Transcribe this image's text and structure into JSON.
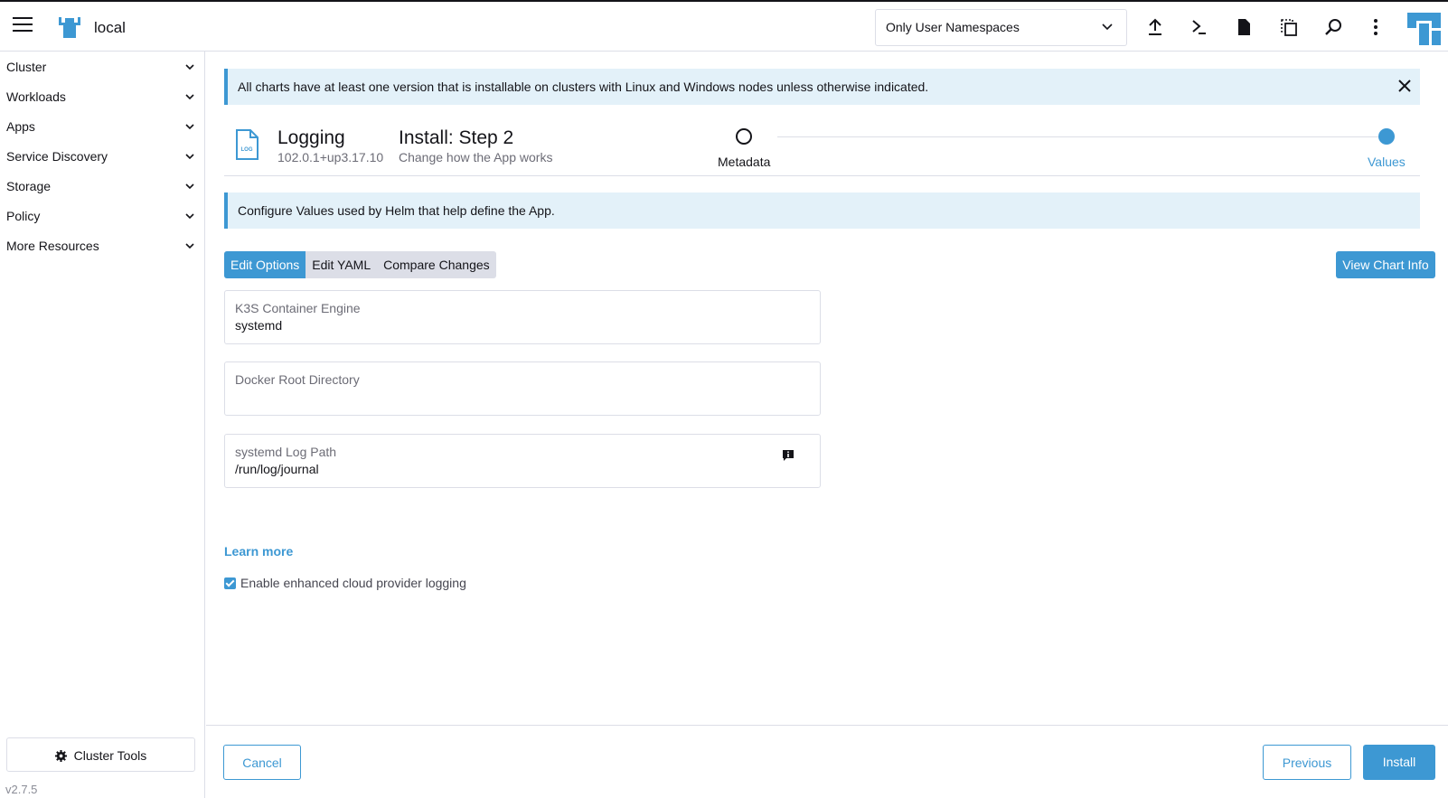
{
  "header": {
    "cluster_name": "local",
    "namespace_select": "Only User Namespaces",
    "icons": [
      "menu-icon",
      "cluster-logo-icon",
      "upload-icon",
      "terminal-icon",
      "file-icon",
      "copy-icon",
      "search-icon",
      "kebab-icon",
      "avatar"
    ]
  },
  "sidebar": {
    "items": [
      {
        "label": "Cluster"
      },
      {
        "label": "Workloads"
      },
      {
        "label": "Apps"
      },
      {
        "label": "Service Discovery"
      },
      {
        "label": "Storage"
      },
      {
        "label": "Policy"
      },
      {
        "label": "More Resources"
      }
    ],
    "cluster_tools": "Cluster Tools",
    "version": "v2.7.5"
  },
  "main": {
    "banner_text": "All charts have at least one version that is installable on clusters with Linux and Windows nodes unless otherwise indicated.",
    "chart_name": "Logging",
    "chart_version": "102.0.1+up3.17.10",
    "chart_icon_text": "LOG",
    "step_title": "Install: Step 2",
    "step_subtitle": "Change how the App works",
    "steps": [
      {
        "label": "Metadata",
        "state": "done"
      },
      {
        "label": "Values",
        "state": "current"
      }
    ],
    "info_banner": "Configure Values used by Helm that help define the App.",
    "tabs": [
      {
        "label": "Edit Options",
        "active": true
      },
      {
        "label": "Edit YAML",
        "active": false
      },
      {
        "label": "Compare Changes",
        "active": false
      }
    ],
    "view_chart_info": "View Chart Info",
    "fields": [
      {
        "label": "K3S Container Engine",
        "value": "systemd"
      },
      {
        "label": "Docker Root Directory",
        "value": ""
      },
      {
        "label": "systemd Log Path",
        "value": "/run/log/journal"
      }
    ],
    "learn_more": "Learn more",
    "checkbox_label": "Enable enhanced cloud provider logging",
    "checkbox_checked": true
  },
  "footer": {
    "cancel": "Cancel",
    "previous": "Previous",
    "install": "Install"
  },
  "colors": {
    "accent": "#3d98d3",
    "banner_bg": "#e3f1f9",
    "border": "#dcdee7"
  }
}
